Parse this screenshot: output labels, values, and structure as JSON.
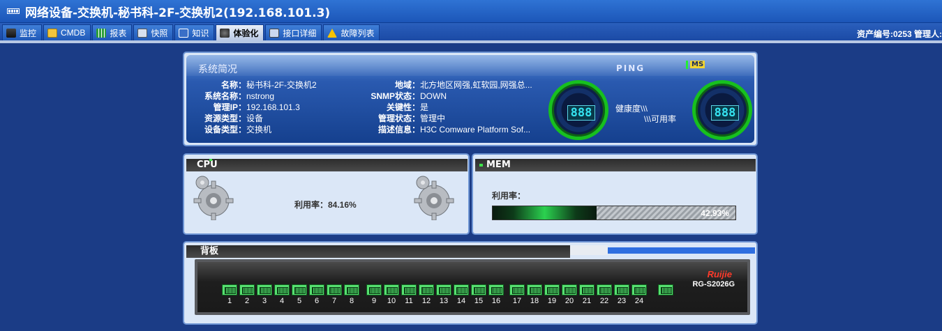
{
  "window": {
    "title": "网络设备-交换机-秘书科-2F-交换机2(192.168.101.3)"
  },
  "tabs": [
    {
      "label": "监控",
      "icon": "binoculars-icon"
    },
    {
      "label": "CMDB",
      "icon": "database-icon"
    },
    {
      "label": "报表",
      "icon": "chart-icon"
    },
    {
      "label": "快照",
      "icon": "snapshot-icon"
    },
    {
      "label": "知识",
      "icon": "knowledge-icon"
    },
    {
      "label": "体验化",
      "icon": "experience-icon",
      "active": true
    },
    {
      "label": "接口详细",
      "icon": "monitor-icon"
    },
    {
      "label": "故障列表",
      "icon": "warning-icon"
    }
  ],
  "header_right": {
    "text": "资产编号:0253  管理人:"
  },
  "summary": {
    "title": "系统简况",
    "left": [
      {
        "label": "名称：",
        "value": "秘书科-2F-交换机2"
      },
      {
        "label": "系统名称：",
        "value": "nstrong"
      },
      {
        "label": "管理IP：",
        "value": "192.168.101.3"
      },
      {
        "label": "资源类型：",
        "value": "设备"
      },
      {
        "label": "设备类型：",
        "value": "交换机"
      }
    ],
    "right": [
      {
        "label": "地域：",
        "value": "北方地区网强,虹软园,网强总..."
      },
      {
        "label": "SNMP状态：",
        "value": "DOWN"
      },
      {
        "label": "关键性：",
        "value": "是"
      },
      {
        "label": "管理状态：",
        "value": "管理中"
      },
      {
        "label": "描述信息：",
        "value": "H3C Comware Platform Sof..."
      }
    ],
    "ping_label": "PING",
    "ms_label": "MS",
    "gauge_left": "888",
    "gauge_right": "888",
    "health_label": "健康度\\\\\\",
    "avail_label": "\\\\\\可用率"
  },
  "cpu": {
    "title": "CPU",
    "usage_text": "利用率：84.16%",
    "usage": 84.16
  },
  "mem": {
    "title": "MEM",
    "usage_label": "利用率：",
    "percent_text": "42.93%",
    "usage": 42.93
  },
  "backplane": {
    "title": "背板",
    "brand": "Ruijie",
    "model": "RG-S2026G",
    "ports": [
      "1",
      "2",
      "3",
      "4",
      "5",
      "6",
      "7",
      "8",
      "9",
      "10",
      "11",
      "12",
      "13",
      "14",
      "15",
      "16",
      "17",
      "18",
      "19",
      "20",
      "21",
      "22",
      "23",
      "24",
      ""
    ]
  },
  "colors": {
    "background": "#1b3c86",
    "accent": "#2f73d4",
    "port_green": "#56e070"
  }
}
